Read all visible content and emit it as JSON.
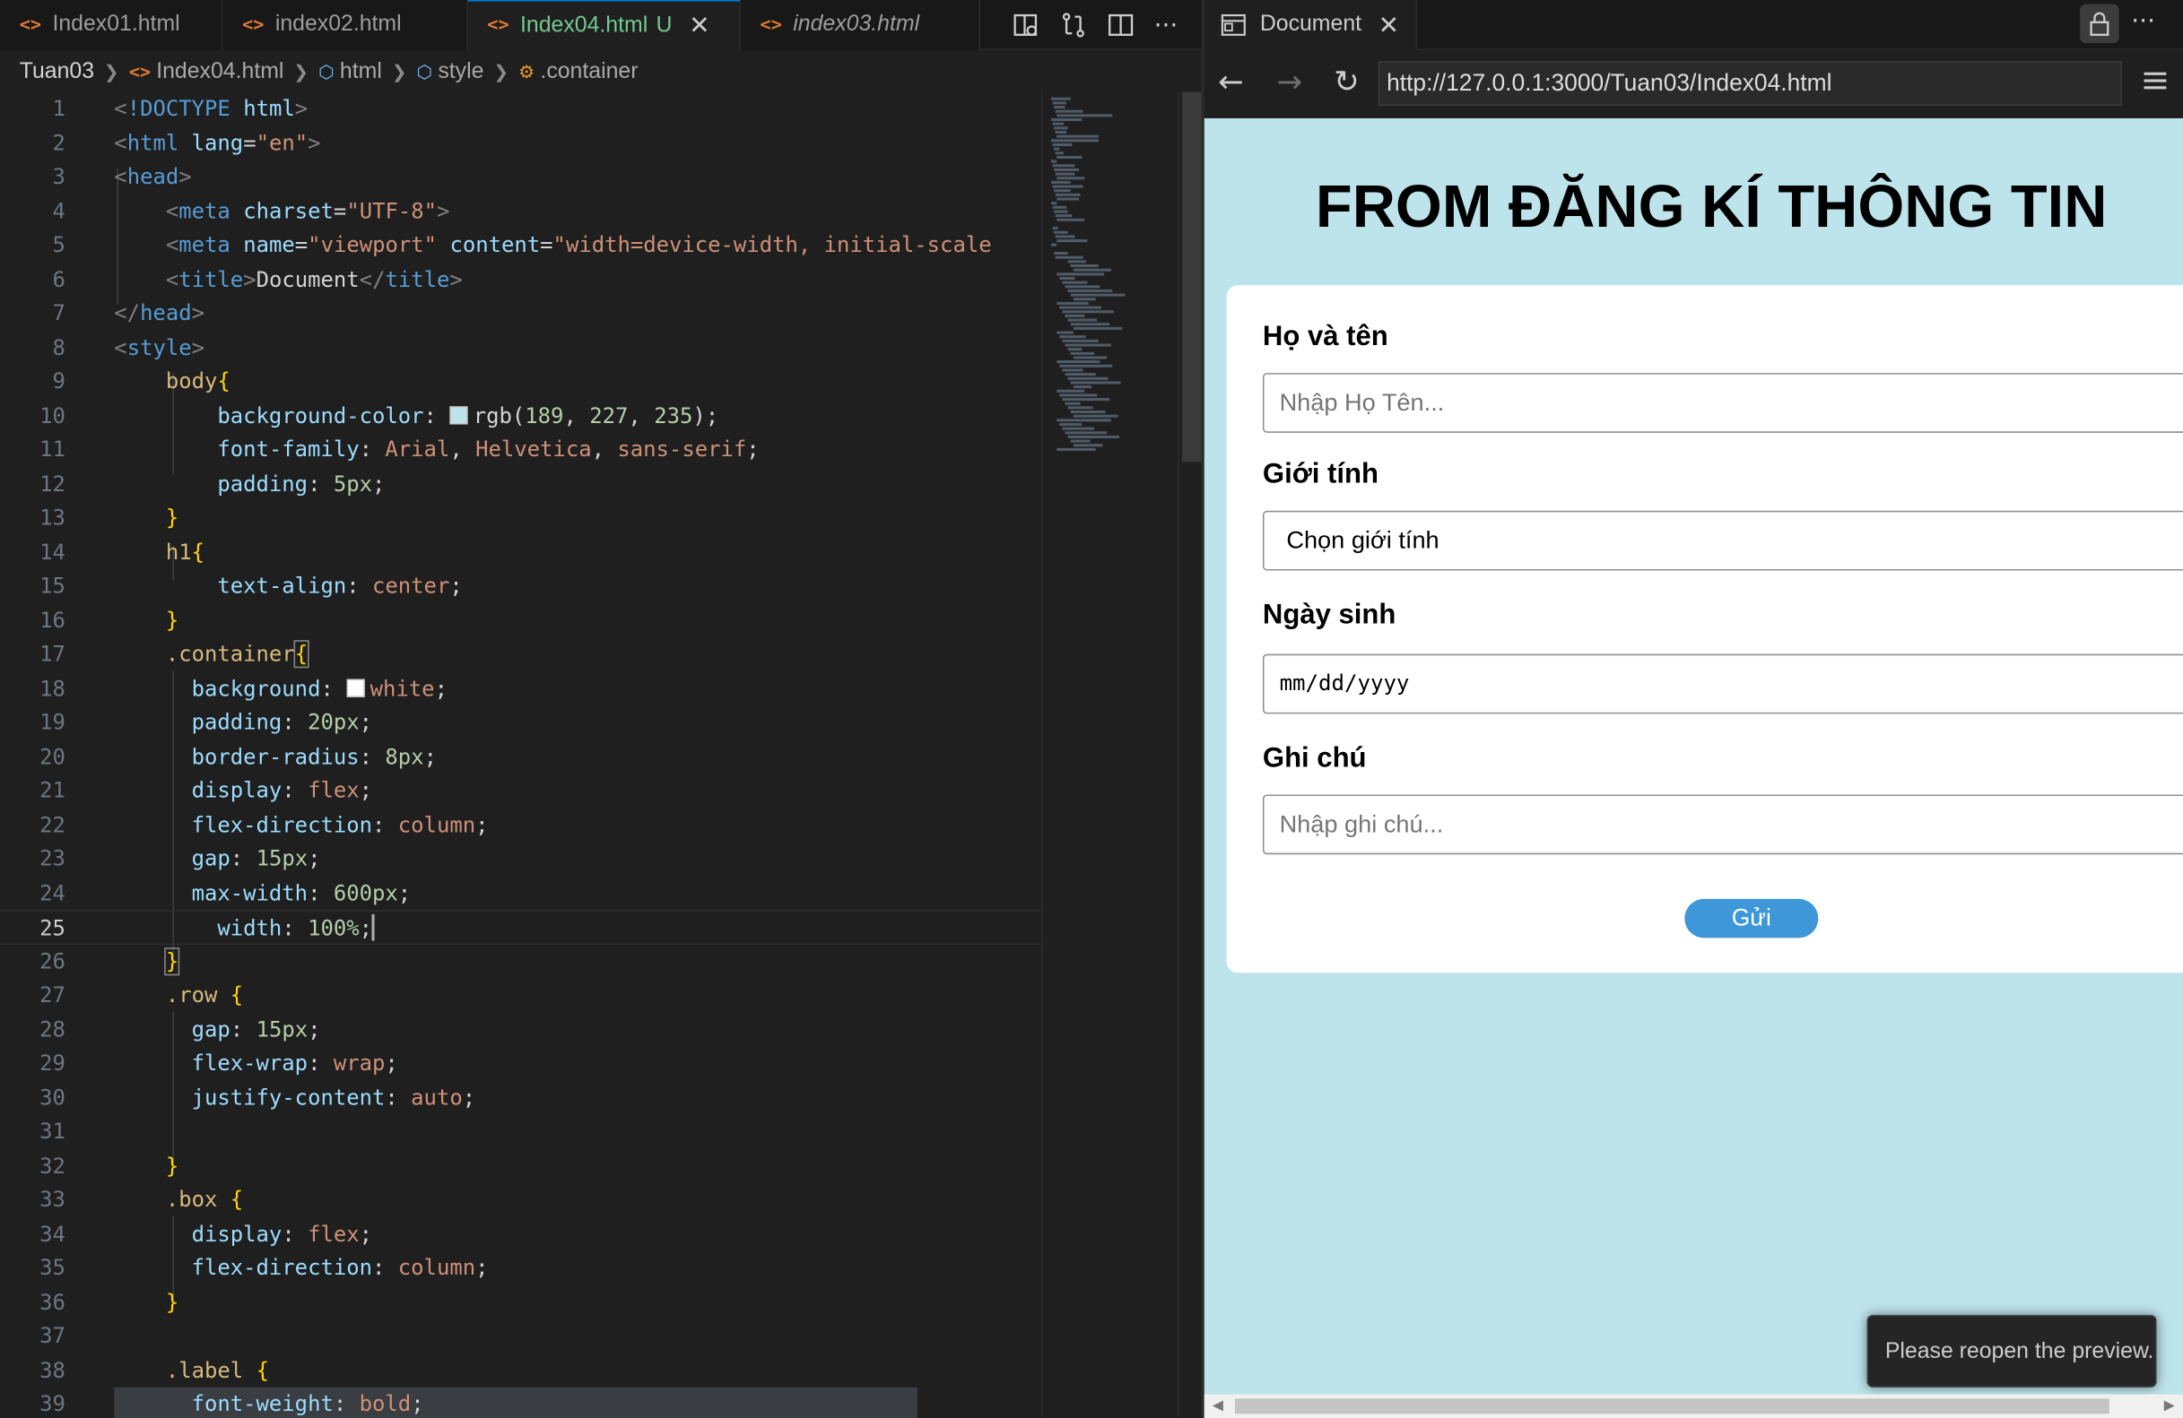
{
  "tabs": [
    {
      "label": "Index01.html",
      "active": false,
      "italic": false
    },
    {
      "label": "index02.html",
      "active": false,
      "italic": false
    },
    {
      "label": "Index04.html",
      "active": true,
      "italic": false,
      "badge": "U"
    },
    {
      "label": "index03.html",
      "active": false,
      "italic": true
    }
  ],
  "breadcrumb": [
    "Tuan03",
    "Index04.html",
    "html",
    "style",
    ".container"
  ],
  "code": {
    "line_numbers": [
      "1",
      "2",
      "3",
      "4",
      "5",
      "6",
      "7",
      "8",
      "9",
      "10",
      "11",
      "12",
      "13",
      "14",
      "15",
      "16",
      "17",
      "18",
      "19",
      "20",
      "21",
      "22",
      "23",
      "24",
      "25",
      "26",
      "27",
      "28",
      "29",
      "30",
      "31",
      "32",
      "33",
      "34",
      "35",
      "36",
      "37",
      "38",
      "39"
    ],
    "current_line": "25"
  },
  "preview": {
    "tab_title": "Document",
    "url": "http://127.0.0.1:3000/Tuan03/Index04.html",
    "heading": "FROM ĐĂNG KÍ THÔNG TIN",
    "fields": [
      {
        "label": "Họ và tên",
        "placeholder": "Nhập Họ Tên..."
      },
      {
        "label": "Giới tính",
        "value": "Chọn giới tính"
      },
      {
        "label": "Ngày sinh",
        "value": "mm/dd/yyyy"
      },
      {
        "label": "Ghi chú",
        "placeholder": "Nhập ghi chú..."
      }
    ],
    "submit_label": "Gửi",
    "bg_color": "#bde3eb",
    "button_color": "#3d97d9"
  },
  "toast": "Please reopen the preview.",
  "colors": {
    "editor_bg": "#1f1f1f",
    "tag": "#569cd6",
    "attr": "#9cdcfe",
    "string": "#ce9178",
    "selector": "#d7ba7d",
    "number": "#b5cea8"
  }
}
